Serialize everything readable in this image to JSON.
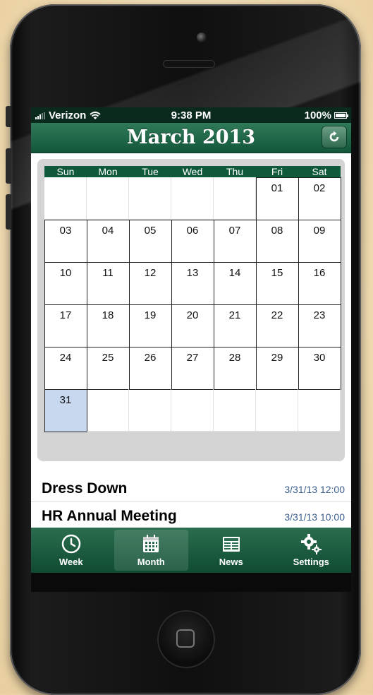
{
  "status_bar": {
    "carrier": "Verizon",
    "time": "9:38 PM",
    "battery": "100%"
  },
  "nav": {
    "title": "March 2013",
    "refresh_icon": "refresh-icon"
  },
  "calendar": {
    "weekdays": [
      "Sun",
      "Mon",
      "Tue",
      "Wed",
      "Thu",
      "Fri",
      "Sat"
    ],
    "weeks": [
      [
        "",
        "",
        "",
        "",
        "",
        "01",
        "02"
      ],
      [
        "03",
        "04",
        "05",
        "06",
        "07",
        "08",
        "09"
      ],
      [
        "10",
        "11",
        "12",
        "13",
        "14",
        "15",
        "16"
      ],
      [
        "17",
        "18",
        "19",
        "20",
        "21",
        "22",
        "23"
      ],
      [
        "24",
        "25",
        "26",
        "27",
        "28",
        "29",
        "30"
      ],
      [
        "31",
        "",
        "",
        "",
        "",
        "",
        ""
      ]
    ],
    "selected_day": "31"
  },
  "events": [
    {
      "title": "Dress Down",
      "time": "3/31/13 12:00"
    },
    {
      "title": "HR Annual Meeting",
      "time": "3/31/13 10:00"
    }
  ],
  "tabs": [
    {
      "label": "Week",
      "icon": "clock-icon"
    },
    {
      "label": "Month",
      "icon": "calendar-icon"
    },
    {
      "label": "News",
      "icon": "newspaper-icon"
    },
    {
      "label": "Settings",
      "icon": "gears-icon"
    }
  ],
  "colors": {
    "accent_green": "#13563b",
    "selected_day": "#c7d8ef",
    "event_time": "#3b5f8f"
  }
}
